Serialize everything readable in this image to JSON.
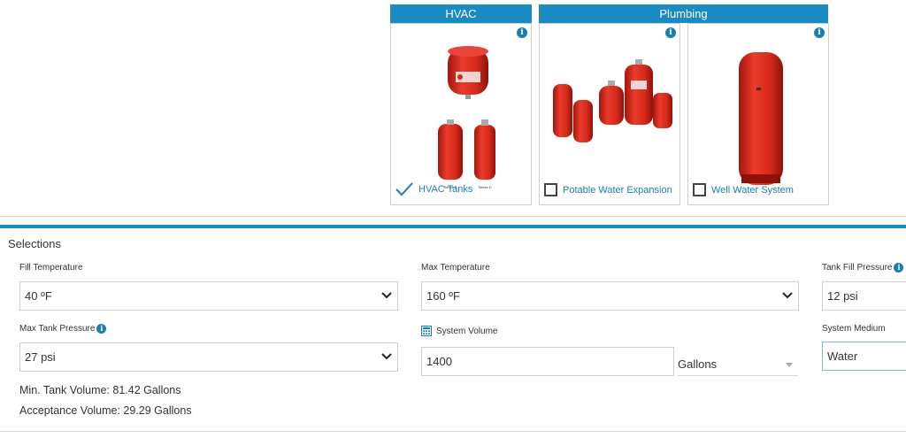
{
  "categories": {
    "hvac": "HVAC",
    "plumbing": "Plumbing"
  },
  "products": [
    {
      "label": "HVAC Tanks",
      "state": "selected"
    },
    {
      "label": "Potable Water Expansion",
      "state": "unchecked"
    },
    {
      "label": "Well Water System",
      "state": "unchecked"
    }
  ],
  "tank_image_text": {
    "series_b": "Series B",
    "series_d": "Series D"
  },
  "info_glyph": "i",
  "section_title": "Selections",
  "fields": {
    "fill_temperature": {
      "label": "Fill Temperature",
      "value": "40 ºF"
    },
    "max_temperature": {
      "label": "Max Temperature",
      "value": "160 ºF"
    },
    "tank_fill_pressure": {
      "label": "Tank Fill Pressure",
      "value": "12 psi"
    },
    "max_tank_pressure": {
      "label": "Max Tank Pressure",
      "value": "27 psi"
    },
    "system_volume": {
      "label": "System Volume",
      "value": "1400",
      "unit": "Gallons"
    },
    "system_medium": {
      "label": "System Medium",
      "value": "Water"
    }
  },
  "results": {
    "min_tank_volume": "Min. Tank Volume: 81.42 Gallons",
    "acceptance_volume": "Acceptance Volume: 29.29 Gallons"
  },
  "colors": {
    "accent": "#1a8bc1",
    "tank_red": "#d92a1c",
    "link": "#1a7fb0"
  }
}
